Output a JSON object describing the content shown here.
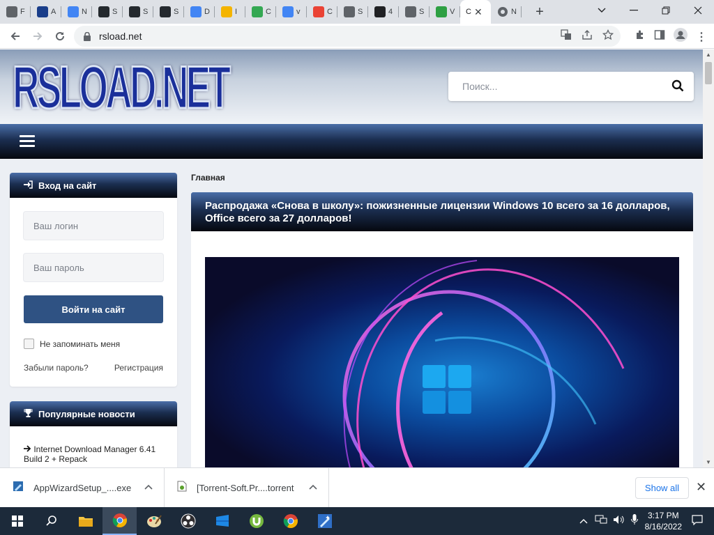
{
  "browser": {
    "tabs": [
      {
        "icon": "page-icon",
        "letter": "F",
        "color": "#5f6368"
      },
      {
        "icon": "edit-icon",
        "letter": "A",
        "color": "#1a3e8a"
      },
      {
        "icon": "google-icon",
        "letter": "N",
        "color": "#4285f4"
      },
      {
        "icon": "github-icon",
        "letter": "S",
        "color": "#24292e"
      },
      {
        "icon": "github-icon",
        "letter": "S",
        "color": "#24292e"
      },
      {
        "icon": "github-icon",
        "letter": "S",
        "color": "#24292e"
      },
      {
        "icon": "google-icon",
        "letter": "D",
        "color": "#4285f4"
      },
      {
        "icon": "id-icon",
        "letter": "I",
        "color": "#f4b400"
      },
      {
        "icon": "ampersand-icon",
        "letter": "C",
        "color": "#34a853"
      },
      {
        "icon": "google-icon",
        "letter": "v",
        "color": "#4285f4"
      },
      {
        "icon": "drive-icon",
        "letter": "C",
        "color": "#ea4335"
      },
      {
        "icon": "globe-icon",
        "letter": "S",
        "color": "#5f6368"
      },
      {
        "icon": "bold-b-icon",
        "letter": "4",
        "color": "#202124"
      },
      {
        "icon": "globe-icon",
        "letter": "S",
        "color": "#5f6368"
      },
      {
        "icon": "windows-icon",
        "letter": "V",
        "color": "#2ea043"
      }
    ],
    "active_tab": {
      "letter": "C"
    },
    "last_tab": {
      "icon": "chrome-icon",
      "letter": "N"
    },
    "url": "rsload.net"
  },
  "site": {
    "logo": "RSLOAD.NET",
    "search_placeholder": "Поиск...",
    "breadcrumb": "Главная"
  },
  "login": {
    "title": "Вход на сайт",
    "login_placeholder": "Ваш логин",
    "password_placeholder": "Ваш пароль",
    "submit": "Войти на сайт",
    "remember": "Не запоминать меня",
    "forgot": "Забыли пароль?",
    "register": "Регистрация"
  },
  "popular": {
    "title": "Популярные новости",
    "items": [
      "Internet Download Manager 6.41 Build 2 + Repack"
    ]
  },
  "article": {
    "title": "Распродажа «Снова в школу»: пожизненные лицензии Windows 10 всего за 16 долларов, Office всего за 27 долларов!"
  },
  "downloads": {
    "items": [
      {
        "name": "AppWizardSetup_....exe"
      },
      {
        "name": "[Torrent-Soft.Pr....torrent"
      }
    ],
    "show_all": "Show all"
  },
  "taskbar": {
    "time": "3:17 PM",
    "date": "8/16/2022"
  }
}
